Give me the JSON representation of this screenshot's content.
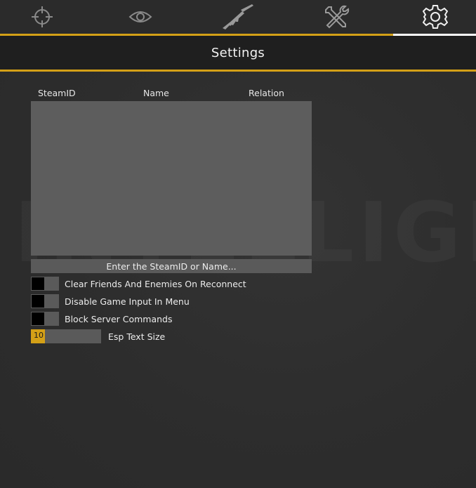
{
  "colors": {
    "accent": "#d4a017",
    "active_tab": "#ffffff",
    "panel": "#5d5d5d"
  },
  "tabs": [
    {
      "icon": "crosshair-icon",
      "active": false
    },
    {
      "icon": "eye-icon",
      "active": false
    },
    {
      "icon": "rifle-icon",
      "active": false
    },
    {
      "icon": "tools-icon",
      "active": false
    },
    {
      "icon": "gear-icon",
      "active": true
    }
  ],
  "header": {
    "title": "Settings"
  },
  "friends_table": {
    "columns": [
      "SteamID",
      "Name",
      "Relation"
    ],
    "rows": []
  },
  "search": {
    "placeholder": "Enter the SteamID or Name..."
  },
  "options": {
    "clear_friends": {
      "label": "Clear Friends And Enemies On Reconnect",
      "checked": false
    },
    "disable_game_input": {
      "label": "Disable Game Input In Menu",
      "checked": false
    },
    "block_server_commands": {
      "label": "Block Server Commands",
      "checked": false
    }
  },
  "esp_text_size": {
    "label": "Esp Text Size",
    "value": "10",
    "fill_fraction": 0.2
  }
}
